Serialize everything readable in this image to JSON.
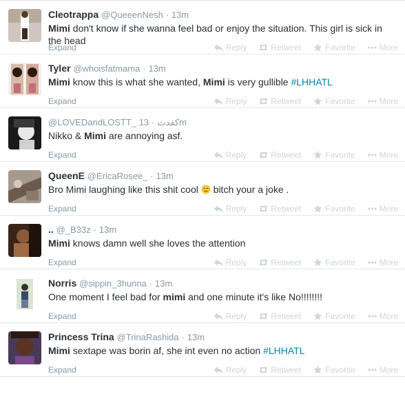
{
  "actions": {
    "reply": "Reply",
    "retweet": "Retweet",
    "favorite": "Favorite",
    "more": "More",
    "expand": "Expand"
  },
  "tweets": [
    {
      "fullname": "Cleotrappa",
      "username": "@QueeenNesh",
      "sep": "·",
      "time": "13m",
      "segments": [
        {
          "t": "Mimi",
          "b": true
        },
        {
          "t": " don't know if she wanna feel bad or enjoy the situation. This girl is sick in the head"
        }
      ]
    },
    {
      "fullname": "Tyler",
      "username": "@whoisfatmama",
      "sep": "·",
      "time": "13m",
      "segments": [
        {
          "t": "Mimi",
          "b": true
        },
        {
          "t": " know this is what she wanted, "
        },
        {
          "t": "Mimi",
          "b": true
        },
        {
          "t": " is very gullible "
        },
        {
          "t": "#LHHATL",
          "h": true
        }
      ]
    },
    {
      "fullname": "",
      "username": "@LOVEDandLOSTT_ كفدث",
      "sep": "·",
      "time": "13m",
      "segments": [
        {
          "t": "Nikko & "
        },
        {
          "t": "Mimi",
          "b": true
        },
        {
          "t": " are annoying asf."
        }
      ]
    },
    {
      "fullname": "QueenE",
      "username": "@EricaRosee_",
      "sep": "·",
      "time": "13m",
      "segments": [
        {
          "t": "Bro Mimi laughing like this shit cool "
        },
        {
          "e": "unamused-face-emoji"
        },
        {
          "t": " bitch your a joke ."
        }
      ]
    },
    {
      "fullname": "..",
      "username": "@_B33z",
      "sep": "·",
      "time": "13m",
      "segments": [
        {
          "t": "Mimi",
          "b": true
        },
        {
          "t": " knows damn well she loves the attention"
        }
      ]
    },
    {
      "fullname": "Norris",
      "username": "@sippin_3hunna",
      "sep": "·",
      "time": "13m",
      "segments": [
        {
          "t": "One moment I feel bad for "
        },
        {
          "t": "mimi",
          "b": true
        },
        {
          "t": " and one minute it's like No!!!!!!!!"
        }
      ]
    },
    {
      "fullname": "Princess Trina",
      "username": "@TrinaRashida",
      "sep": "·",
      "time": "13m",
      "segments": [
        {
          "t": "Mimi",
          "b": true
        },
        {
          "t": " sextape was borin af,  she int even no action "
        },
        {
          "t": "#LHHATL",
          "h": true
        }
      ]
    }
  ],
  "colors": {
    "hashtag": "#0084b4",
    "muted": "#8899a6",
    "action": "#ccd6dd",
    "divider": "#e1e8ed"
  },
  "icons": [
    "reply-icon",
    "retweet-icon",
    "favorite-icon",
    "more-icon"
  ]
}
